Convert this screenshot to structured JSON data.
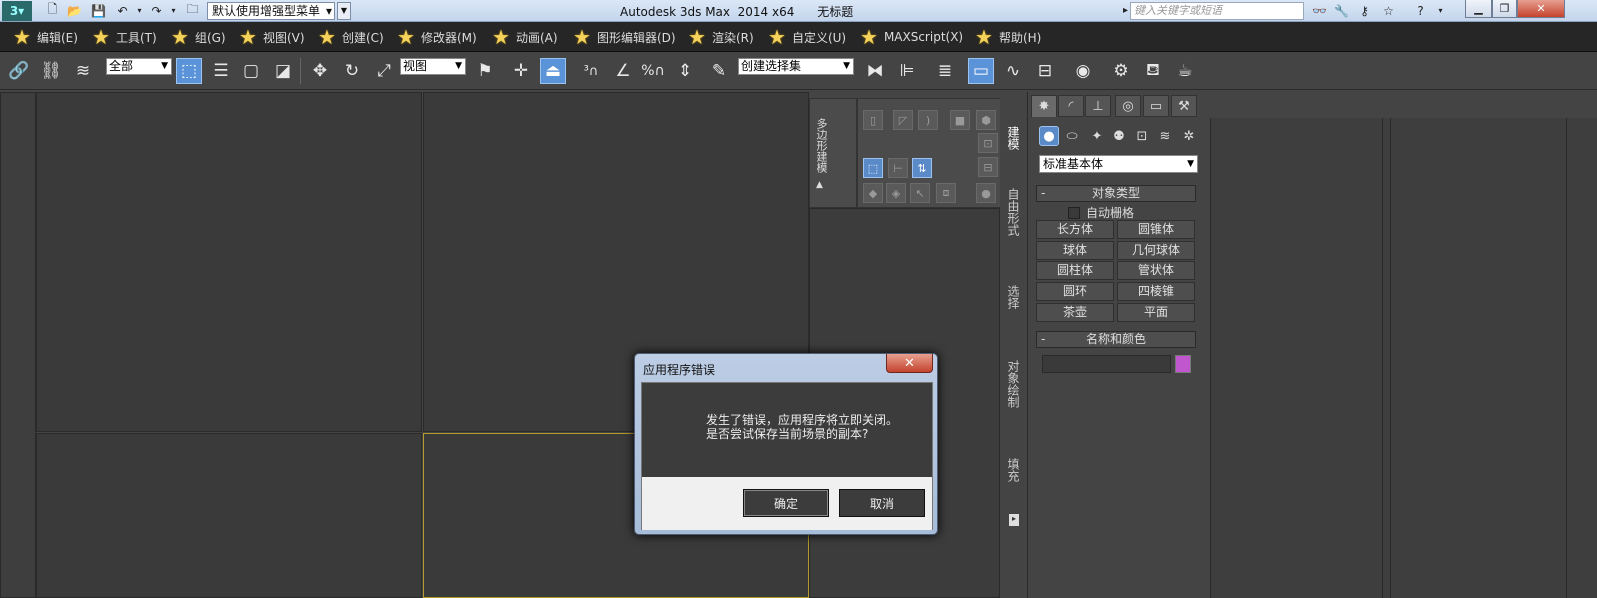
{
  "titlebar": {
    "workspace": "默认使用增强型菜单",
    "app_title": "Autodesk 3ds Max  2014 x64",
    "doc_title": "无标题",
    "search_placeholder": "键入关键字或短语"
  },
  "menu": [
    "编辑(E)",
    "工具(T)",
    "组(G)",
    "视图(V)",
    "创建(C)",
    "修改器(M)",
    "动画(A)",
    "图形编辑器(D)",
    "渲染(R)",
    "自定义(U)",
    "MAXScript(X)",
    "帮助(H)"
  ],
  "toolbar": {
    "filter": "全部",
    "ref_coord": "视图",
    "selection_set": "创建选择集"
  },
  "ribbon": {
    "panel_label": "多边形建模"
  },
  "vertical_tabs": [
    "建模",
    "自由形式",
    "选择",
    "对象绘制",
    "填充"
  ],
  "command_panel": {
    "category_dropdown": "标准基本体",
    "object_type": {
      "title": "对象类型",
      "autogrid": "自动栅格",
      "buttons": [
        "长方体",
        "圆锥体",
        "球体",
        "几何球体",
        "圆柱体",
        "管状体",
        "圆环",
        "四棱锥",
        "茶壶",
        "平面"
      ]
    },
    "name_color": {
      "title": "名称和颜色",
      "color": "#c157cf"
    }
  },
  "dialog": {
    "title": "应用程序错误",
    "line1": "发生了错误，应用程序将立即关闭。",
    "line2": "是否尝试保存当前场景的副本?",
    "ok": "确定",
    "cancel": "取消"
  }
}
